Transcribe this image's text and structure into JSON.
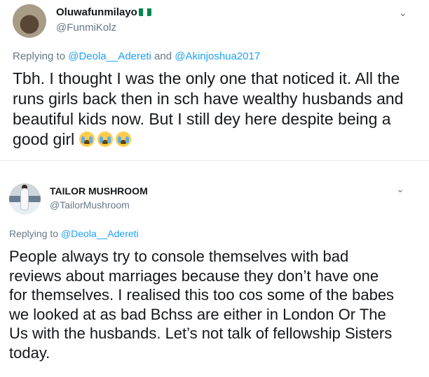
{
  "tweets": [
    {
      "display_name": "Oluwafunmilayo",
      "flag_colors": [
        "#008751",
        "#ffffff",
        "#008751"
      ],
      "handle": "@FunmiKolz",
      "avatar_icon": "profile-photo",
      "more_icon": "chevron-down-icon",
      "replying_prefix": "Replying to",
      "replying_mentions": [
        "@Deola__Adereti",
        "@Akinjoshua2017"
      ],
      "replying_joiner": "and",
      "body_lines": [
        "Tbh. I thought I was the only one that noticed it. All the",
        "runs girls back then in sch have wealthy husbands and",
        "beautiful kids now. But I still dey here despite being a",
        "good girl"
      ],
      "emoji_icon": "loudly-crying-face-icon",
      "emoji_count": 3
    },
    {
      "display_name": "TAILOR MUSHROOM",
      "handle": "@TailorMushroom",
      "avatar_icon": "profile-photo",
      "more_icon": "chevron-down-icon",
      "replying_prefix": "Replying to",
      "replying_mentions": [
        "@Deola__Adereti"
      ],
      "body_lines": [
        "People always try to console themselves with bad",
        "reviews about marriages because they don’t have one",
        "for themselves. I realised this too cos some of the babes",
        "we looked at as bad Bchss are either in London Or The",
        "Us with the husbands. Let’s not talk of fellowship Sisters",
        "today."
      ]
    }
  ],
  "colors": {
    "text": "#14171a",
    "secondary": "#657786",
    "link": "#1da1f2",
    "divider": "#e6ecf0"
  }
}
